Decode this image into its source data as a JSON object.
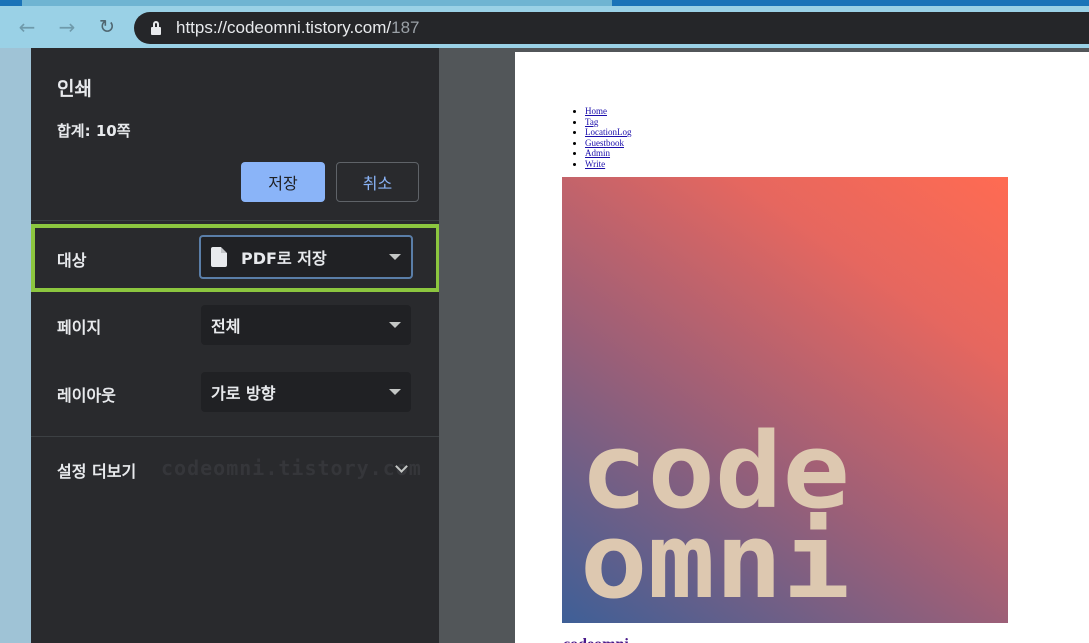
{
  "browser": {
    "url_host": "https://codeomni.tistory.com/",
    "url_path": "187"
  },
  "print": {
    "title": "인쇄",
    "total": "합계: 10쪽",
    "save_label": "저장",
    "cancel_label": "취소",
    "destination": {
      "label": "대상",
      "value": "PDF로 저장"
    },
    "pages": {
      "label": "페이지",
      "value": "전체"
    },
    "layout": {
      "label": "레이아웃",
      "value": "가로 방향"
    },
    "more_settings": "설정 더보기",
    "watermark": "codeomni.tistory.com"
  },
  "preview": {
    "nav_links": [
      "Home",
      "Tag",
      "LocationLog",
      "Guestbook",
      "Admin",
      "Write"
    ],
    "cover_text": [
      "code",
      "omni"
    ],
    "under_title": "codeomni"
  },
  "colors": {
    "accent": "#8ab4f8",
    "highlight": "#8cc63f",
    "panel_bg": "#292a2d",
    "preview_bg": "#525659"
  }
}
